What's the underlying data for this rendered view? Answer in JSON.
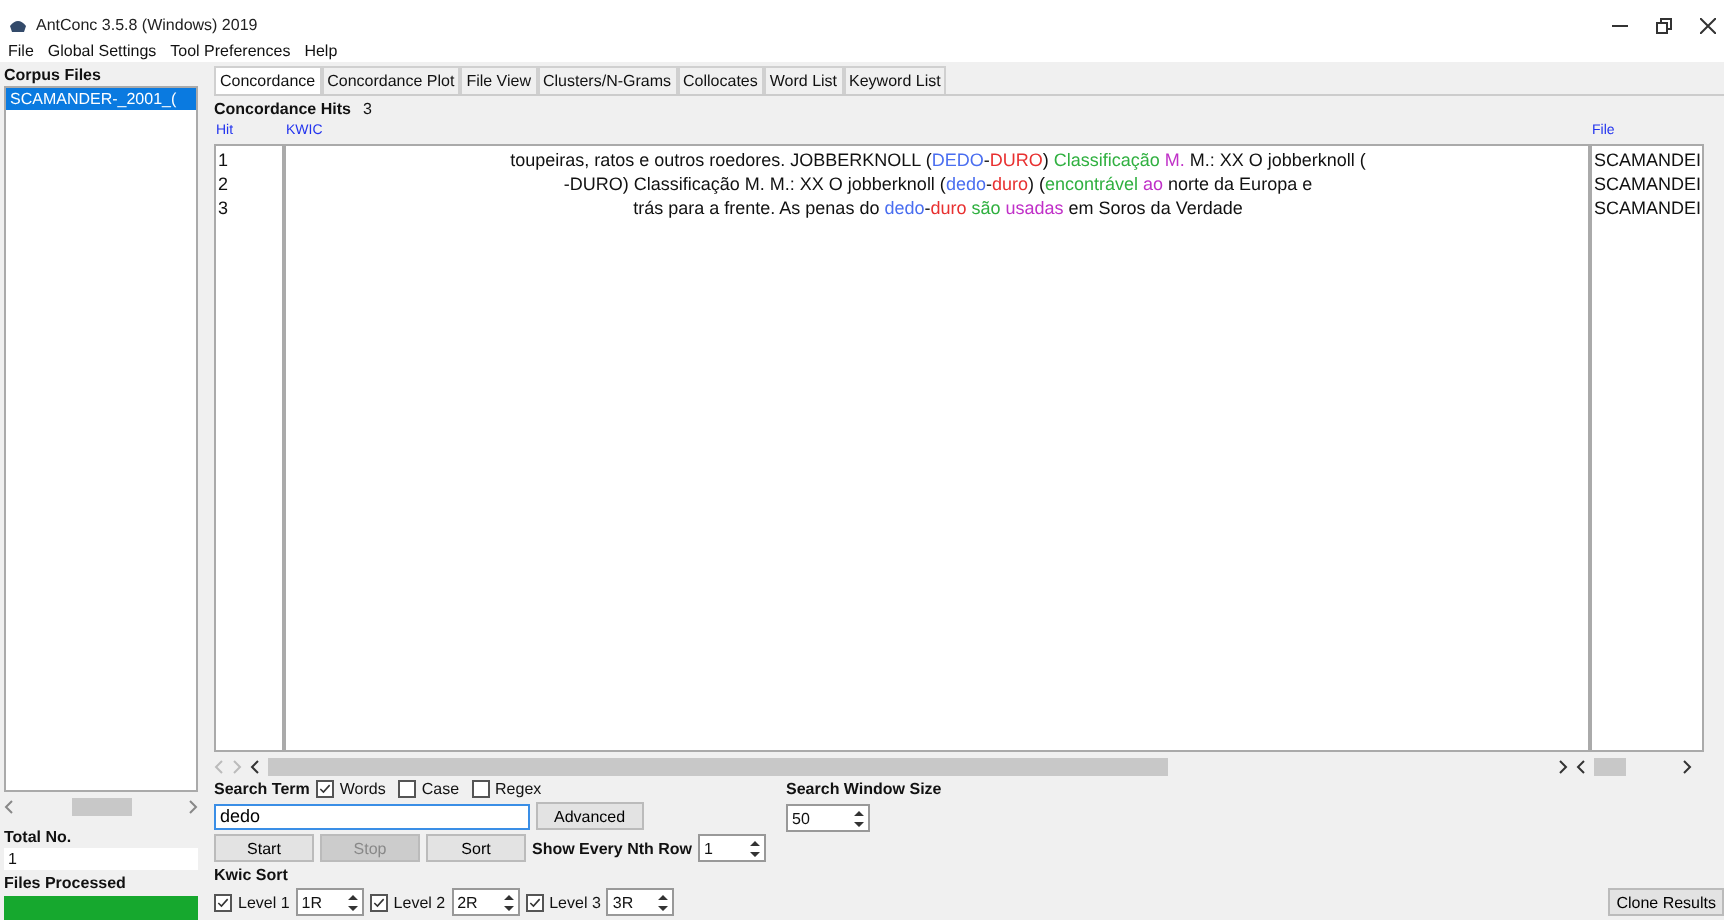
{
  "window": {
    "title": "AntConc 3.5.8 (Windows) 2019"
  },
  "menu": [
    "File",
    "Global Settings",
    "Tool Preferences",
    "Help"
  ],
  "corpus_files": {
    "title": "Corpus Files",
    "files": [
      {
        "name": "SCAMANDER-_2001_(",
        "selected": true
      }
    ]
  },
  "total_no": {
    "label": "Total No.",
    "value": "1"
  },
  "files_processed": {
    "label": "Files Processed",
    "level": 1
  },
  "tabs": [
    {
      "label": "Concordance",
      "selected": true
    },
    {
      "label": "Concordance Plot",
      "selected": false
    },
    {
      "label": "File View",
      "selected": false
    },
    {
      "label": "Clusters/N-Grams",
      "selected": false
    },
    {
      "label": "Collocates",
      "selected": false
    },
    {
      "label": "Word List",
      "selected": false
    },
    {
      "label": "Keyword List",
      "selected": false
    }
  ],
  "hits": {
    "label": "Concordance Hits",
    "count": "3"
  },
  "table": {
    "columns": [
      "Hit",
      "KWIC",
      "File"
    ],
    "rows": [
      {
        "hit": "1",
        "kwic": [
          {
            "text": "toupeiras, ratos e outros roedores.  JOBBERKNOLL ("
          },
          {
            "text": "DEDO",
            "color": "#4a6ef0"
          },
          {
            "text": "-"
          },
          {
            "text": "DURO",
            "color": "#e83030"
          },
          {
            "text": ") "
          },
          {
            "text": "Classificação ",
            "color": "#30b040"
          },
          {
            "text": "M.",
            "color": "#c030c8"
          },
          {
            "text": " M.: XX O jobberknoll ("
          }
        ],
        "file": "SCAMANDEI"
      },
      {
        "hit": "2",
        "kwic": [
          {
            "text": "-DURO) Classificação M. M.: XX O jobberknoll ("
          },
          {
            "text": "dedo",
            "color": "#4a6ef0"
          },
          {
            "text": "-"
          },
          {
            "text": "duro",
            "color": "#e83030"
          },
          {
            "text": ") ("
          },
          {
            "text": "encontrável ",
            "color": "#30b040"
          },
          {
            "text": "ao",
            "color": "#c030c8"
          },
          {
            "text": " norte da Europa e"
          }
        ],
        "file": "SCAMANDEI"
      },
      {
        "hit": "3",
        "kwic": [
          {
            "text": "trás para a frente. As penas do  "
          },
          {
            "text": "dedo",
            "color": "#4a6ef0"
          },
          {
            "text": "-"
          },
          {
            "text": "duro ",
            "color": "#e83030"
          },
          {
            "text": "são ",
            "color": "#30b040"
          },
          {
            "text": "usadas",
            "color": "#c030c8"
          },
          {
            "text": " em Soros da Verdade"
          }
        ],
        "file": "SCAMANDEI"
      }
    ]
  },
  "search": {
    "label": "Search Term",
    "options": [
      {
        "label": "Words",
        "checked": true
      },
      {
        "label": "Case",
        "checked": false
      },
      {
        "label": "Regex",
        "checked": false
      }
    ],
    "value": "dedo",
    "advanced": "Advanced"
  },
  "buttons": [
    {
      "label": "Start",
      "disabled": false
    },
    {
      "label": "Stop",
      "disabled": true
    },
    {
      "label": "Sort",
      "disabled": false
    }
  ],
  "nth_row": {
    "label": "Show Every Nth Row",
    "value": "1"
  },
  "window_size": {
    "label": "Search Window Size",
    "value": "50"
  },
  "kwic_sort": {
    "label": "Kwic Sort",
    "levels": [
      {
        "label": "Level 1",
        "checked": true,
        "value": "1R"
      },
      {
        "label": "Level 2",
        "checked": true,
        "value": "2R"
      },
      {
        "label": "Level 3",
        "checked": true,
        "value": "3R"
      }
    ]
  },
  "clone": "Clone Results"
}
